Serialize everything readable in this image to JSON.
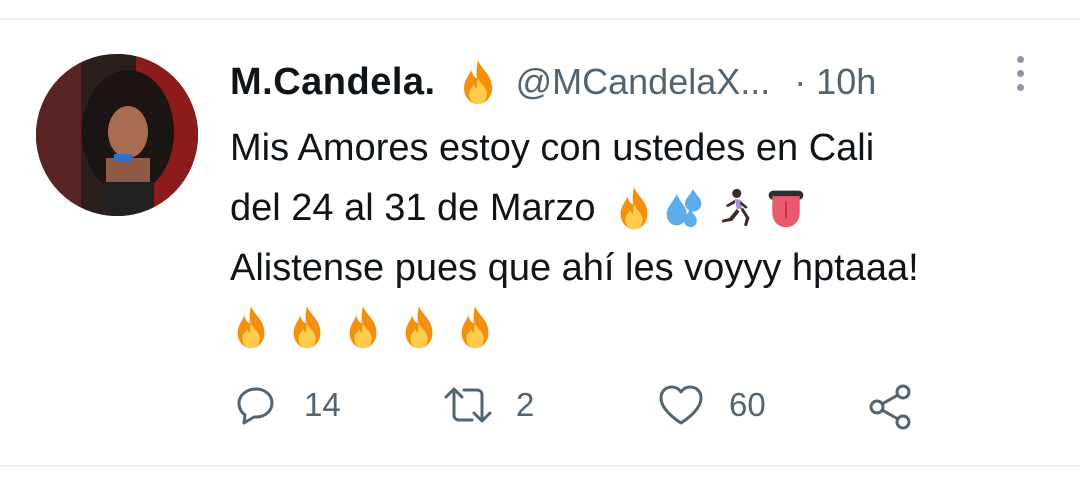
{
  "tweet": {
    "display_name": "M.Candela.",
    "handle": "@MCandelaX...",
    "time": "· 10h",
    "line1": "Mis Amores estoy con ustedes en Cali",
    "line2": "del 24 al 31 de Marzo",
    "line3": "Alistense pues que ahí les voyyy hptaaa!"
  },
  "icons": {
    "name_emoji": "fire-icon",
    "line2_emojis": [
      "fire-icon",
      "sweat-droplets-icon",
      "running-woman-icon",
      "tongue-icon"
    ],
    "line4_emojis": [
      "fire-icon",
      "fire-icon",
      "fire-icon",
      "fire-icon",
      "fire-icon"
    ],
    "more": "more-vertical-icon"
  },
  "actions": {
    "reply_count": "14",
    "retweet_count": "2",
    "like_count": "60"
  },
  "colors": {
    "text": "#0f1419",
    "secondary": "#536471",
    "divider": "#eff3f4"
  }
}
